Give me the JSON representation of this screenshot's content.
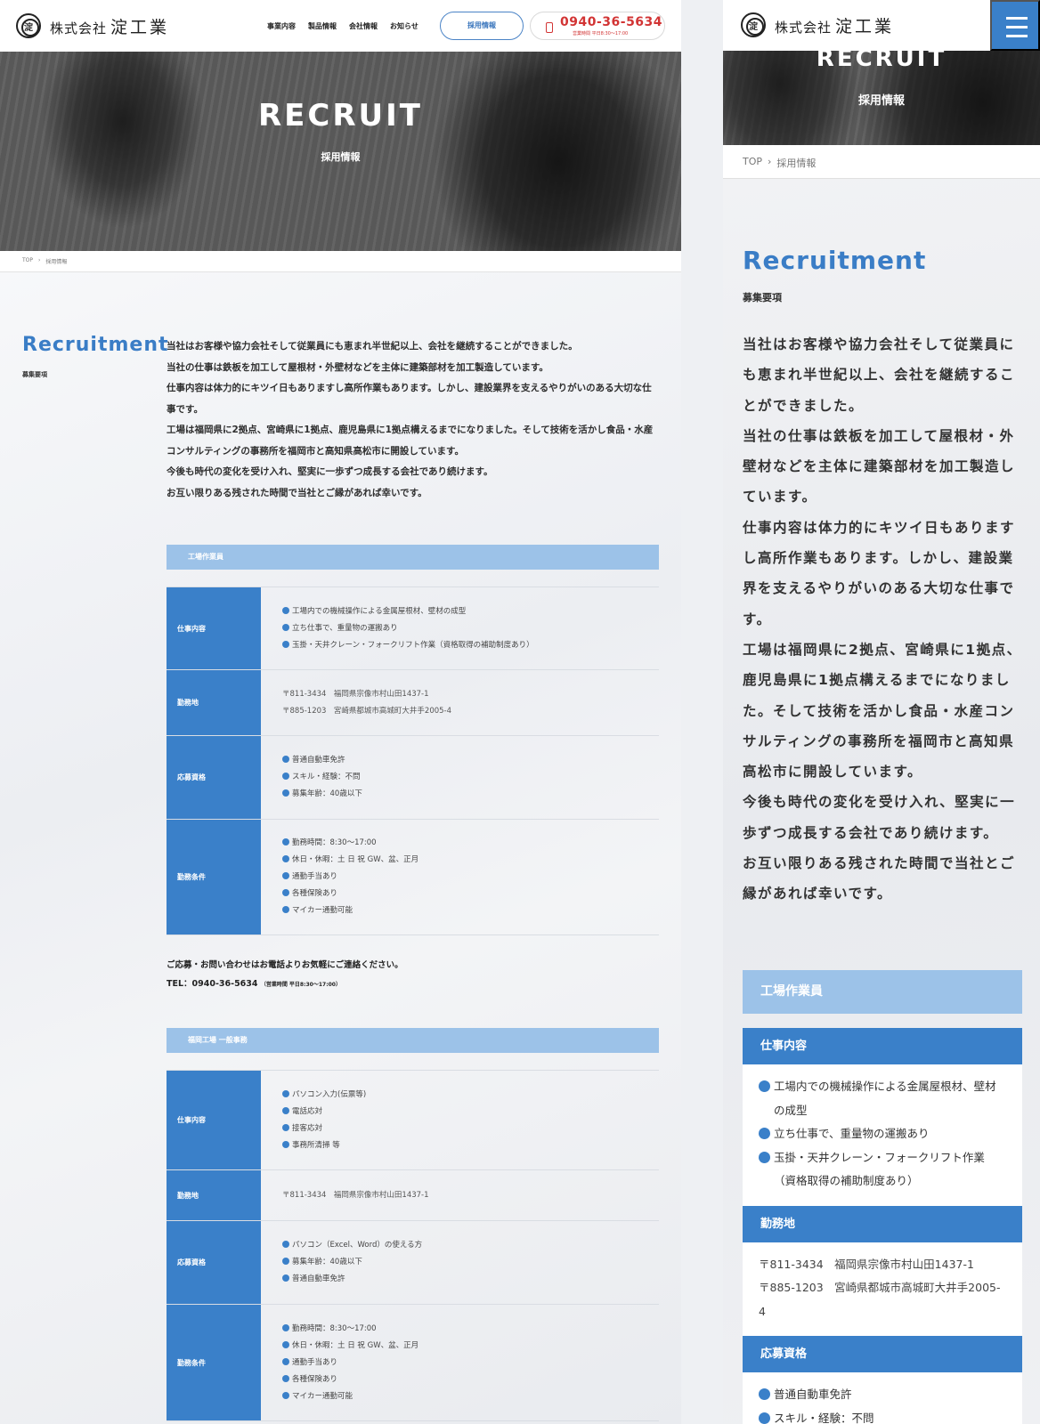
{
  "header": {
    "logo_prefix": "株式会社",
    "logo_name": "淀工業",
    "logo_mark": "淀",
    "nav": [
      "事業内容",
      "製品情報",
      "会社情報",
      "お知らせ"
    ],
    "recruit_button": "採用情報",
    "tel": "0940-36-5634",
    "tel_hours": "営業時間 平日8:30〜17:00"
  },
  "hero": {
    "title": "RECRUIT",
    "subtitle": "採用情報"
  },
  "breadcrumb": {
    "home": "TOP",
    "sep": "›",
    "current": "採用情報"
  },
  "section": {
    "title": "Recruitment",
    "subtitle": "募集要項"
  },
  "intro": [
    "当社はお客様や協力会社そして従業員にも恵まれ半世紀以上、会社を継続することができました。",
    "当社の仕事は鉄板を加工して屋根材・外壁材などを主体に建築部材を加工製造しています。",
    "仕事内容は体力的にキツイ日もありますし高所作業もあります。しかし、建設業界を支えるやりがいのある大切な仕事です。",
    "工場は福岡県に2拠点、宮崎県に1拠点、鹿児島県に1拠点構えるまでになりました。そして技術を活かし食品・水産コンサルティングの事務所を福岡市と高知県高松市に開設しています。",
    "今後も時代の変化を受け入れ、堅実に一歩ずつ成長する会社であり続けます。",
    "お互い限りある残された時間で当社とご縁があれば幸いです。"
  ],
  "jobs": [
    {
      "title": "工場作業員",
      "rows": [
        {
          "label": "仕事内容",
          "type": "bullets",
          "items": [
            "工場内での機械操作による金属屋根材、壁材の成型",
            "立ち仕事で、重量物の運搬あり",
            "玉掛・天井クレーン・フォークリフト作業（資格取得の補助制度あり）"
          ]
        },
        {
          "label": "勤務地",
          "type": "plain",
          "items": [
            "〒811-3434　福岡県宗像市村山田1437-1",
            "〒885-1203　宮崎県都城市高城町大井手2005-4"
          ]
        },
        {
          "label": "応募資格",
          "type": "bullets",
          "items": [
            "普通自動車免許",
            "スキル・経験：不問",
            "募集年齢：40歳以下"
          ]
        },
        {
          "label": "勤務条件",
          "type": "bullets",
          "items": [
            "勤務時間：8:30〜17:00",
            "休日・休暇：土 日 祝 GW、盆、正月",
            "通勤手当あり",
            "各種保険あり",
            "マイカー通勤可能"
          ]
        }
      ]
    },
    {
      "title": "福岡工場 一般事務",
      "rows": [
        {
          "label": "仕事内容",
          "type": "bullets",
          "items": [
            "パソコン入力(伝票等)",
            "電話応対",
            "接客応対",
            "事務所清掃 等"
          ]
        },
        {
          "label": "勤務地",
          "type": "plain",
          "items": [
            "〒811-3434　福岡県宗像市村山田1437-1"
          ]
        },
        {
          "label": "応募資格",
          "type": "bullets",
          "items": [
            "パソコン（Excel、Word）の使える方",
            "募集年齢：40歳以下",
            "普通自動車免許"
          ]
        },
        {
          "label": "勤務条件",
          "type": "bullets",
          "items": [
            "勤務時間：8:30〜17:00",
            "休日・休暇：土 日 祝 GW、盆、正月",
            "通勤手当あり",
            "各種保険あり",
            "マイカー通勤可能"
          ]
        }
      ]
    }
  ],
  "contact": {
    "line1": "ご応募・お問い合わせはお電話よりお気軽にご連絡ください。",
    "tel": "TEL：0940-36-5634",
    "hours": "（営業時間 平日8:30〜17:00）"
  },
  "mobile": {
    "intro_paragraphs": [
      "当社はお客様や協力会社そして従業員にも恵まれ半世紀以上、会社を継続することができました。",
      "当社の仕事は鉄板を加工して屋根材・外壁材などを主体に建築部材を加工製造しています。",
      "仕事内容は体力的にキツイ日もありますし高所作業もあります。しかし、建設業界を支えるやりがいのある大切な仕事です。",
      "工場は福岡県に2拠点、宮崎県に1拠点、鹿児島県に1拠点構えるまでになりました。そして技術を活かし食品・水産コンサルティングの事務所を福岡市と高知県高松市に開設しています。",
      "今後も時代の変化を受け入れ、堅実に一歩ずつ成長する会社であり続けます。",
      "お互い限りある残された時間で当社とご縁があれば幸いです。"
    ],
    "job_title": "工場作業員",
    "rows": [
      {
        "label": "仕事内容",
        "type": "bullets",
        "items": [
          "工場内での機械操作による金属屋根材、壁材の成型",
          "立ち仕事で、重量物の運搬あり",
          "玉掛・天井クレーン・フォークリフト作業（資格取得の補助制度あり）"
        ]
      },
      {
        "label": "勤務地",
        "type": "plain",
        "items": [
          "〒811-3434　福岡県宗像市村山田1437-1",
          "〒885-1203　宮崎県都城市高城町大井手2005-4"
        ]
      },
      {
        "label": "応募資格",
        "type": "bullets",
        "items": [
          "普通自動車免許",
          "スキル・経験：不問"
        ]
      }
    ]
  }
}
